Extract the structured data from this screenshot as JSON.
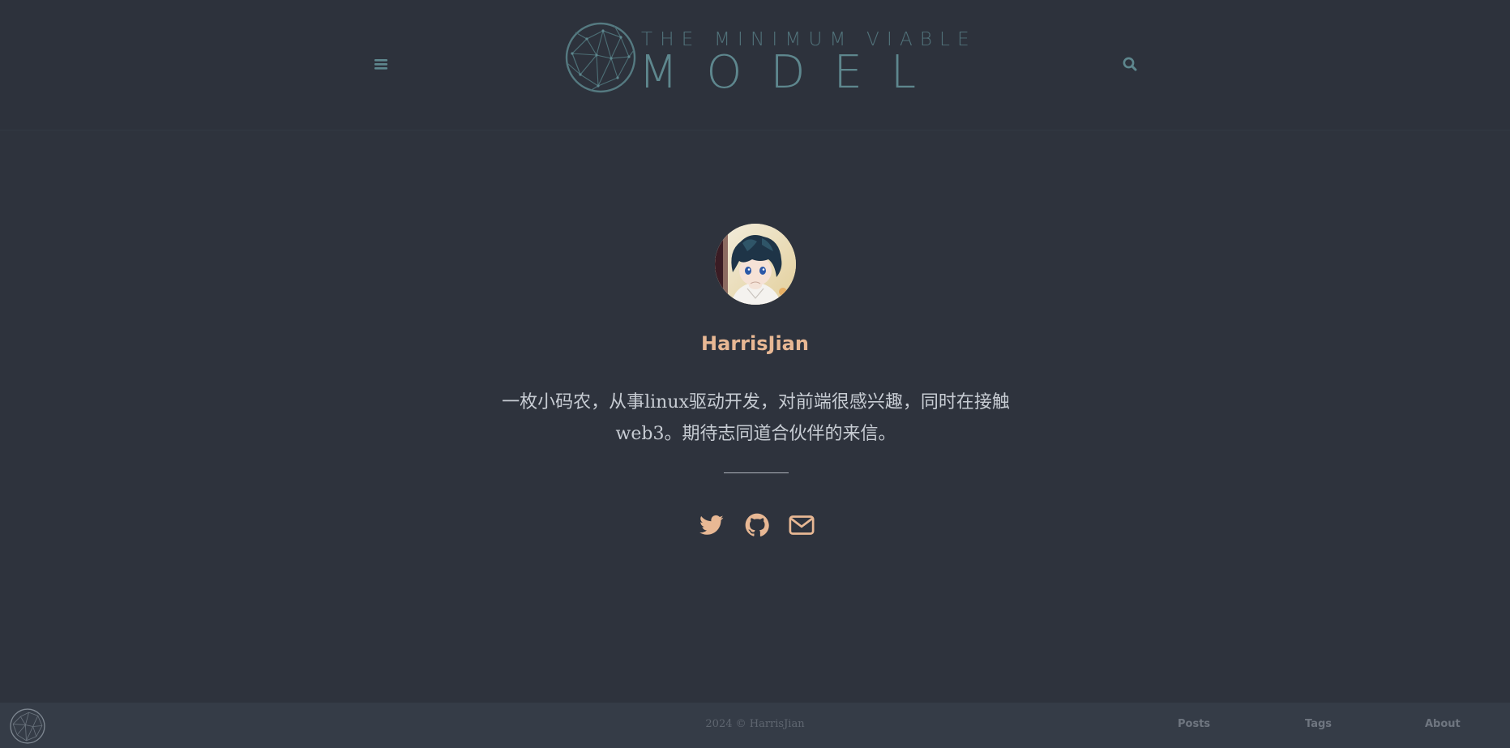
{
  "site": {
    "logo_top": "THE MINIMUM VIABLE",
    "logo_bottom": "MODEL",
    "accent_color": "#e8b894",
    "logo_color": "#5e878e"
  },
  "header": {
    "menu_icon": "bars-icon",
    "search_icon": "search-icon"
  },
  "profile": {
    "name": "HarrisJian",
    "bio_line1": "一枚小码农，从事linux驱动开发，对前端很感兴趣，同时在接触",
    "bio_line2": "web3。期待志同道合伙伴的来信。",
    "avatar_alt": "avatar"
  },
  "social": [
    {
      "icon": "twitter-icon"
    },
    {
      "icon": "github-icon"
    },
    {
      "icon": "envelope-icon"
    }
  ],
  "footer": {
    "copyright": "2024 © HarrisJian",
    "links": [
      {
        "label": "Posts"
      },
      {
        "label": "Tags"
      },
      {
        "label": "About"
      }
    ]
  }
}
